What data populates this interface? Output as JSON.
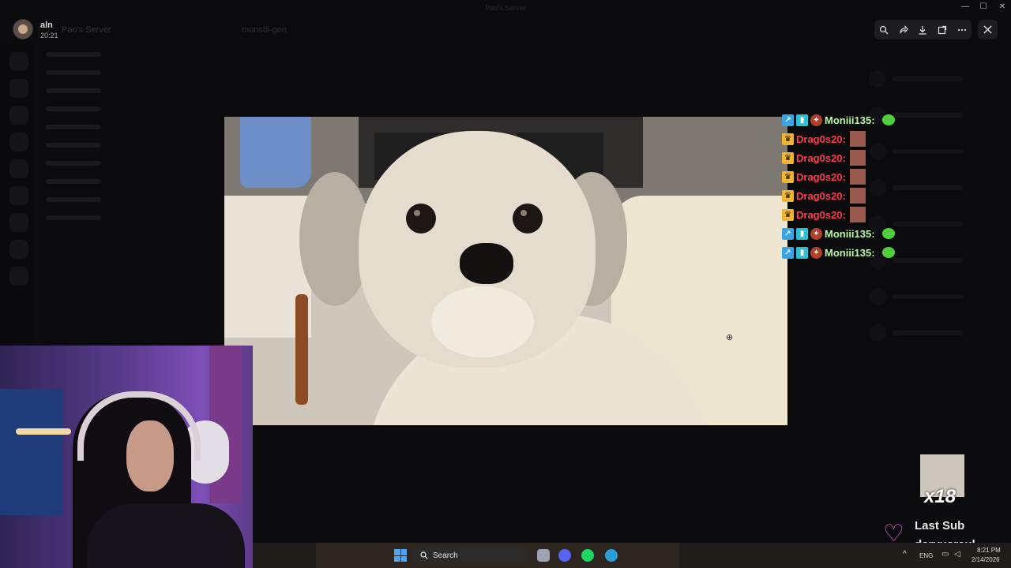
{
  "window": {
    "title": "Pao's Server"
  },
  "user": {
    "name": "aln",
    "time": "20:21"
  },
  "server": {
    "name": "Pao's Server"
  },
  "channel": {
    "name": "monstii-gen"
  },
  "toolbar": {
    "zoom": "zoom-icon",
    "forward": "forward-icon",
    "download": "download-icon",
    "open": "open-external-icon",
    "more": "more-icon",
    "close": "close-icon"
  },
  "chat": {
    "messages": [
      {
        "user": "Moniii135:",
        "color": "#b9f7a6",
        "badges": [
          "blue",
          "teal",
          "red"
        ],
        "emote": "frog"
      },
      {
        "user": "Drag0s20:",
        "color": "#ff3b4e",
        "badges": [
          "crown"
        ],
        "emote": "drag"
      },
      {
        "user": "Drag0s20:",
        "color": "#ff3b4e",
        "badges": [
          "crown"
        ],
        "emote": "drag"
      },
      {
        "user": "Drag0s20:",
        "color": "#ff3b4e",
        "badges": [
          "crown"
        ],
        "emote": "drag"
      },
      {
        "user": "Drag0s20:",
        "color": "#ff3b4e",
        "badges": [
          "crown"
        ],
        "emote": "drag"
      },
      {
        "user": "Drag0s20:",
        "color": "#ff3b4e",
        "badges": [
          "crown"
        ],
        "emote": "drag"
      },
      {
        "user": "Moniii135:",
        "color": "#b9f7a6",
        "badges": [
          "blue",
          "teal",
          "red"
        ],
        "emote": "frog"
      },
      {
        "user": "Moniii135:",
        "color": "#b9f7a6",
        "badges": [
          "blue",
          "teal",
          "red"
        ],
        "emote": "frog"
      }
    ]
  },
  "last_sub": {
    "count": "x18",
    "label": "Last Sub",
    "username": "daryusraul"
  },
  "taskbar": {
    "search_placeholder": "Search",
    "language": "ENG",
    "time": "8:21 PM",
    "date": "2/14/2026"
  },
  "colors": {
    "accent_heart": "#e24cd3",
    "chat_red": "#ff3b4e",
    "chat_green": "#b9f7a6"
  }
}
